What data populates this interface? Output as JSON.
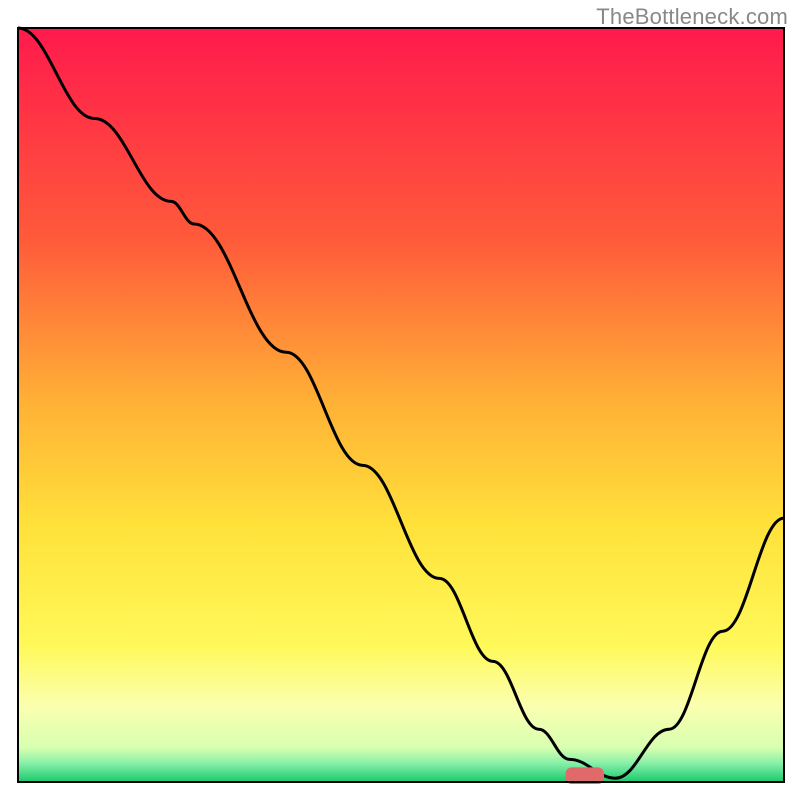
{
  "watermark": "TheBottleneck.com",
  "chart_data": {
    "type": "line",
    "title": "",
    "xlabel": "",
    "ylabel": "",
    "xlim": [
      0,
      100
    ],
    "ylim": [
      0,
      100
    ],
    "background_gradient": {
      "stops": [
        {
          "offset": 0,
          "color": "#ff1a4c"
        },
        {
          "offset": 0.28,
          "color": "#ff5a3a"
        },
        {
          "offset": 0.5,
          "color": "#ffb236"
        },
        {
          "offset": 0.66,
          "color": "#ffe13a"
        },
        {
          "offset": 0.82,
          "color": "#fff95a"
        },
        {
          "offset": 0.9,
          "color": "#fbffb0"
        },
        {
          "offset": 0.955,
          "color": "#d7ffb0"
        },
        {
          "offset": 0.975,
          "color": "#88f0a8"
        },
        {
          "offset": 1.0,
          "color": "#18c96e"
        }
      ]
    },
    "series": [
      {
        "name": "bottleneck-curve",
        "x": [
          0,
          10,
          20,
          23,
          35,
          45,
          55,
          62,
          68,
          72,
          78,
          85,
          92,
          100
        ],
        "y": [
          100,
          88,
          77,
          74,
          57,
          42,
          27,
          16,
          7,
          3,
          0.5,
          7,
          20,
          35
        ]
      }
    ],
    "marker": {
      "name": "optimal-point",
      "x": 74,
      "y": 0,
      "width": 5,
      "height": 2.2,
      "color": "#e06a6a"
    },
    "axes": {
      "frame_color": "#000000",
      "frame_width": 2,
      "plot_margin": {
        "left": 18,
        "right": 16,
        "top": 28,
        "bottom": 18
      }
    }
  }
}
